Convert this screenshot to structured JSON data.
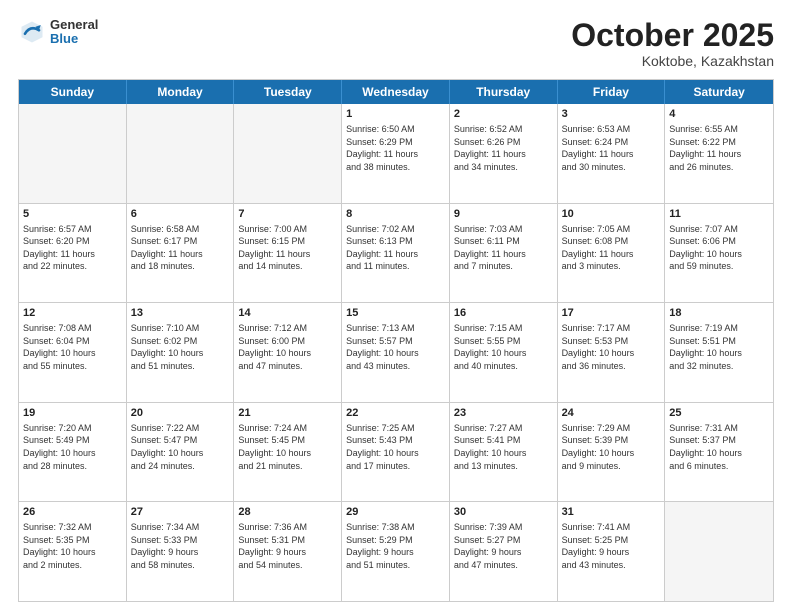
{
  "header": {
    "logo": {
      "general": "General",
      "blue": "Blue"
    },
    "title": "October 2025",
    "subtitle": "Koktobe, Kazakhstan"
  },
  "weekdays": [
    "Sunday",
    "Monday",
    "Tuesday",
    "Wednesday",
    "Thursday",
    "Friday",
    "Saturday"
  ],
  "rows": [
    [
      {
        "day": "",
        "text": "",
        "empty": true
      },
      {
        "day": "",
        "text": "",
        "empty": true
      },
      {
        "day": "",
        "text": "",
        "empty": true
      },
      {
        "day": "1",
        "text": "Sunrise: 6:50 AM\nSunset: 6:29 PM\nDaylight: 11 hours\nand 38 minutes."
      },
      {
        "day": "2",
        "text": "Sunrise: 6:52 AM\nSunset: 6:26 PM\nDaylight: 11 hours\nand 34 minutes."
      },
      {
        "day": "3",
        "text": "Sunrise: 6:53 AM\nSunset: 6:24 PM\nDaylight: 11 hours\nand 30 minutes."
      },
      {
        "day": "4",
        "text": "Sunrise: 6:55 AM\nSunset: 6:22 PM\nDaylight: 11 hours\nand 26 minutes."
      }
    ],
    [
      {
        "day": "5",
        "text": "Sunrise: 6:57 AM\nSunset: 6:20 PM\nDaylight: 11 hours\nand 22 minutes."
      },
      {
        "day": "6",
        "text": "Sunrise: 6:58 AM\nSunset: 6:17 PM\nDaylight: 11 hours\nand 18 minutes."
      },
      {
        "day": "7",
        "text": "Sunrise: 7:00 AM\nSunset: 6:15 PM\nDaylight: 11 hours\nand 14 minutes."
      },
      {
        "day": "8",
        "text": "Sunrise: 7:02 AM\nSunset: 6:13 PM\nDaylight: 11 hours\nand 11 minutes."
      },
      {
        "day": "9",
        "text": "Sunrise: 7:03 AM\nSunset: 6:11 PM\nDaylight: 11 hours\nand 7 minutes."
      },
      {
        "day": "10",
        "text": "Sunrise: 7:05 AM\nSunset: 6:08 PM\nDaylight: 11 hours\nand 3 minutes."
      },
      {
        "day": "11",
        "text": "Sunrise: 7:07 AM\nSunset: 6:06 PM\nDaylight: 10 hours\nand 59 minutes."
      }
    ],
    [
      {
        "day": "12",
        "text": "Sunrise: 7:08 AM\nSunset: 6:04 PM\nDaylight: 10 hours\nand 55 minutes."
      },
      {
        "day": "13",
        "text": "Sunrise: 7:10 AM\nSunset: 6:02 PM\nDaylight: 10 hours\nand 51 minutes."
      },
      {
        "day": "14",
        "text": "Sunrise: 7:12 AM\nSunset: 6:00 PM\nDaylight: 10 hours\nand 47 minutes."
      },
      {
        "day": "15",
        "text": "Sunrise: 7:13 AM\nSunset: 5:57 PM\nDaylight: 10 hours\nand 43 minutes."
      },
      {
        "day": "16",
        "text": "Sunrise: 7:15 AM\nSunset: 5:55 PM\nDaylight: 10 hours\nand 40 minutes."
      },
      {
        "day": "17",
        "text": "Sunrise: 7:17 AM\nSunset: 5:53 PM\nDaylight: 10 hours\nand 36 minutes."
      },
      {
        "day": "18",
        "text": "Sunrise: 7:19 AM\nSunset: 5:51 PM\nDaylight: 10 hours\nand 32 minutes."
      }
    ],
    [
      {
        "day": "19",
        "text": "Sunrise: 7:20 AM\nSunset: 5:49 PM\nDaylight: 10 hours\nand 28 minutes."
      },
      {
        "day": "20",
        "text": "Sunrise: 7:22 AM\nSunset: 5:47 PM\nDaylight: 10 hours\nand 24 minutes."
      },
      {
        "day": "21",
        "text": "Sunrise: 7:24 AM\nSunset: 5:45 PM\nDaylight: 10 hours\nand 21 minutes."
      },
      {
        "day": "22",
        "text": "Sunrise: 7:25 AM\nSunset: 5:43 PM\nDaylight: 10 hours\nand 17 minutes."
      },
      {
        "day": "23",
        "text": "Sunrise: 7:27 AM\nSunset: 5:41 PM\nDaylight: 10 hours\nand 13 minutes."
      },
      {
        "day": "24",
        "text": "Sunrise: 7:29 AM\nSunset: 5:39 PM\nDaylight: 10 hours\nand 9 minutes."
      },
      {
        "day": "25",
        "text": "Sunrise: 7:31 AM\nSunset: 5:37 PM\nDaylight: 10 hours\nand 6 minutes."
      }
    ],
    [
      {
        "day": "26",
        "text": "Sunrise: 7:32 AM\nSunset: 5:35 PM\nDaylight: 10 hours\nand 2 minutes."
      },
      {
        "day": "27",
        "text": "Sunrise: 7:34 AM\nSunset: 5:33 PM\nDaylight: 9 hours\nand 58 minutes."
      },
      {
        "day": "28",
        "text": "Sunrise: 7:36 AM\nSunset: 5:31 PM\nDaylight: 9 hours\nand 54 minutes."
      },
      {
        "day": "29",
        "text": "Sunrise: 7:38 AM\nSunset: 5:29 PM\nDaylight: 9 hours\nand 51 minutes."
      },
      {
        "day": "30",
        "text": "Sunrise: 7:39 AM\nSunset: 5:27 PM\nDaylight: 9 hours\nand 47 minutes."
      },
      {
        "day": "31",
        "text": "Sunrise: 7:41 AM\nSunset: 5:25 PM\nDaylight: 9 hours\nand 43 minutes."
      },
      {
        "day": "",
        "text": "",
        "empty": true
      }
    ]
  ]
}
